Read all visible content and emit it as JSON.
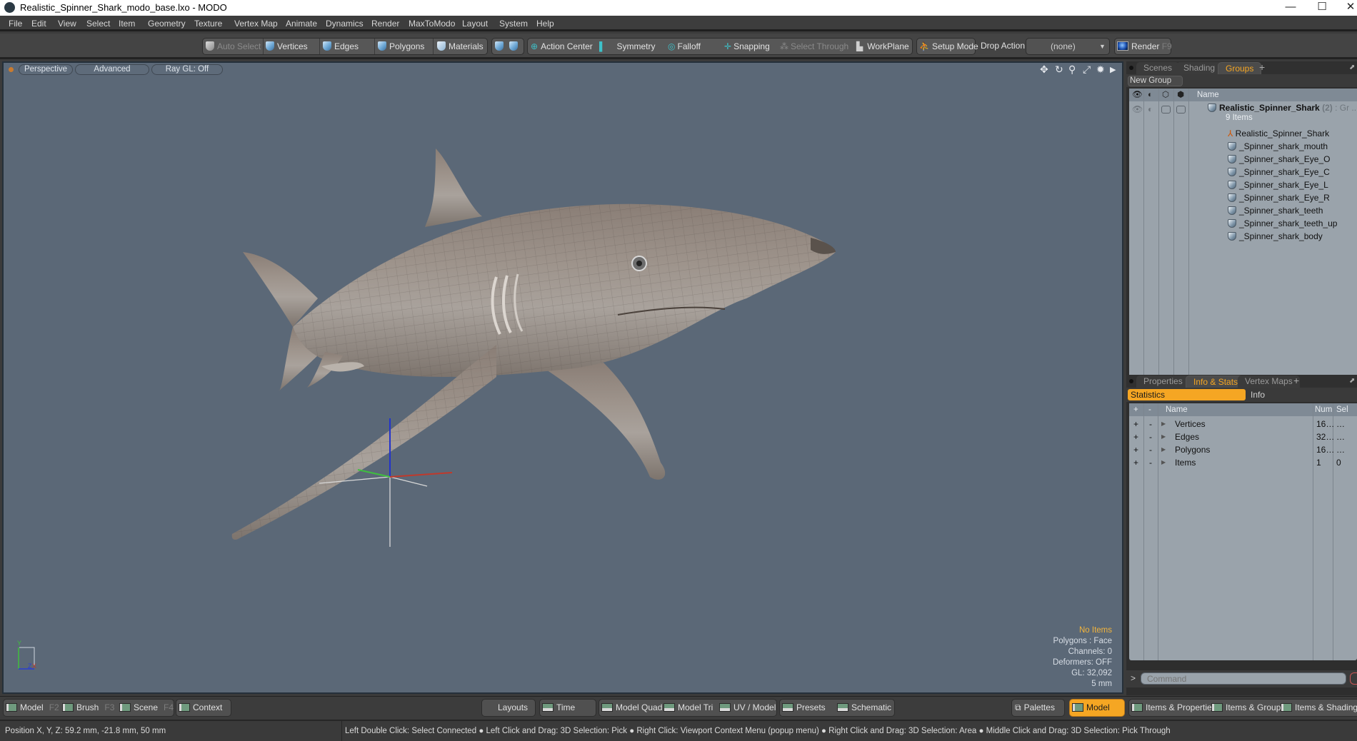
{
  "window": {
    "title": "Realistic_Spinner_Shark_modo_base.lxo - MODO",
    "controls": {
      "minimize": "—",
      "maximize": "☐",
      "close": "✕"
    }
  },
  "menu": [
    "File",
    "Edit",
    "View",
    "Select",
    "Item",
    "Geometry",
    "Texture",
    "Vertex Map",
    "Animate",
    "Dynamics",
    "Render",
    "MaxToModo",
    "Layout",
    "System",
    "Help"
  ],
  "toolbar": {
    "auto_select": "Auto Select",
    "vertices": "Vertices",
    "edges": "Edges",
    "polygons": "Polygons",
    "materials": "Materials",
    "action_center": "Action Center",
    "symmetry": "Symmetry",
    "falloff": "Falloff",
    "snapping": "Snapping",
    "select_through": "Select Through",
    "workplane": "WorkPlane",
    "setup_mode": "Setup Mode",
    "drop_action_label": "Drop Action",
    "drop_action_value": "(none)",
    "render": "Render",
    "render_key": "F9"
  },
  "viewport": {
    "view_mode": "Perspective",
    "shading": "Advanced",
    "raygl": "Ray GL: Off",
    "info": {
      "selection": "No Items",
      "polygons": "Polygons : Face",
      "channels": "Channels: 0",
      "deformers": "Deformers: OFF",
      "gl": "GL: 32,092",
      "grid": "5 mm"
    },
    "axis_labels": {
      "x": "X",
      "y": "Y",
      "z": "Z"
    },
    "colors": {
      "background": "#5b6877",
      "x_axis": "#c0392b",
      "y_axis": "#3fbf3f",
      "z_axis": "#2233cc",
      "accent": "#f5a623"
    }
  },
  "groups_panel": {
    "tabs": [
      "Scenes",
      "Shading",
      "Groups"
    ],
    "active_tab": "Groups",
    "new_group": "New Group",
    "column_name": "Name",
    "group": {
      "name": "Realistic_Spinner_Shark",
      "count": "(2)",
      "suffix": ": Gr ...",
      "subtitle": "9 Items"
    },
    "items": [
      {
        "name": "Realistic_Spinner_Shark",
        "type": "locator"
      },
      {
        "name": "_Spinner_shark_mouth",
        "type": "mesh"
      },
      {
        "name": "_Spinner_shark_Eye_O",
        "type": "mesh"
      },
      {
        "name": "_Spinner_shark_Eye_C",
        "type": "mesh"
      },
      {
        "name": "_Spinner_shark_Eye_L",
        "type": "mesh"
      },
      {
        "name": "_Spinner_shark_Eye_R",
        "type": "mesh"
      },
      {
        "name": "_Spinner_shark_teeth",
        "type": "mesh"
      },
      {
        "name": "_Spinner_shark_teeth_up",
        "type": "mesh"
      },
      {
        "name": "_Spinner_shark_body",
        "type": "mesh"
      }
    ]
  },
  "stats_panel": {
    "tabs": [
      "Properties",
      "Info & Stats",
      "Vertex Maps"
    ],
    "active_tab": "Info & Stats",
    "subtabs": [
      "Statistics",
      "Info"
    ],
    "active_subtab": "Statistics",
    "columns": {
      "plus": "+",
      "minus": "-",
      "name": "Name",
      "num": "Num",
      "sel": "Sel"
    },
    "rows": [
      {
        "name": "Vertices",
        "num": "16…",
        "sel": "…"
      },
      {
        "name": "Edges",
        "num": "32…",
        "sel": "…"
      },
      {
        "name": "Polygons",
        "num": "16…",
        "sel": "…"
      },
      {
        "name": "Items",
        "num": "1",
        "sel": "0"
      }
    ],
    "command_prompt": ">",
    "command_placeholder": "Command"
  },
  "layout_bar": {
    "left": [
      {
        "label": "Model",
        "key": "F2"
      },
      {
        "label": "Brush",
        "key": "F3"
      },
      {
        "label": "Scene",
        "key": "F4"
      },
      {
        "label": "Context",
        "key": ""
      }
    ],
    "center": [
      "Layouts",
      "Time",
      "Model Quad",
      "Model Tri",
      "UV / Model",
      "Presets",
      "Schematic"
    ],
    "palettes": "Palettes",
    "right": [
      "Model",
      "Items & Properties",
      "Items & Groups",
      "Items & Shading"
    ],
    "active_right": "Model"
  },
  "status": {
    "position": "Position X, Y, Z:   59.2 mm, -21.8 mm, 50 mm",
    "hints": [
      "Left Double Click: Select Connected",
      "Left Click and Drag: 3D Selection: Pick",
      "Right Click: Viewport Context Menu (popup menu)",
      "Right Click and Drag: 3D Selection: Area",
      "Middle Click and Drag: 3D Selection: Pick Through"
    ]
  }
}
